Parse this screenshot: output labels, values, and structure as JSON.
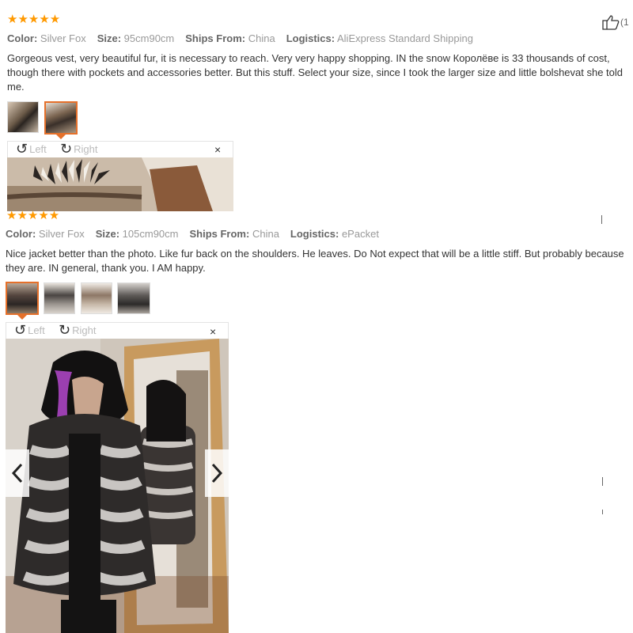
{
  "colors": {
    "star": "#ff9900",
    "accent": "#e5702a"
  },
  "like": {
    "count_text": "(1"
  },
  "reviews": [
    {
      "stars": "★★★★★",
      "meta": [
        {
          "key": "Color:",
          "value": "Silver Fox"
        },
        {
          "key": "Size:",
          "value": "95cm90cm"
        },
        {
          "key": "Ships From:",
          "value": "China"
        },
        {
          "key": "Logistics:",
          "value": "AliExpress Standard Shipping"
        }
      ],
      "text": "Gorgeous vest, very beautiful fur, it is necessary to reach. Very very happy shopping. IN the snow Королёве is 33 thousands of cost, though there with pockets and accessories better. But this stuff. Select your size, since I took the larger size and little bolshevat she told me.",
      "rotate_left": "Left",
      "rotate_right": "Right",
      "close": "×"
    },
    {
      "stars": "★★★★★",
      "meta": [
        {
          "key": "Color:",
          "value": "Silver Fox"
        },
        {
          "key": "Size:",
          "value": "105cm90cm"
        },
        {
          "key": "Ships From:",
          "value": "China"
        },
        {
          "key": "Logistics:",
          "value": "ePacket"
        }
      ],
      "text": "Nice jacket better than the photo. Like fur back on the shoulders. He leaves. Do Not expect that will be a little stiff. But probably because they are. IN general, thank you. I AM happy.",
      "rotate_left": "Left",
      "rotate_right": "Right",
      "close": "×"
    }
  ]
}
